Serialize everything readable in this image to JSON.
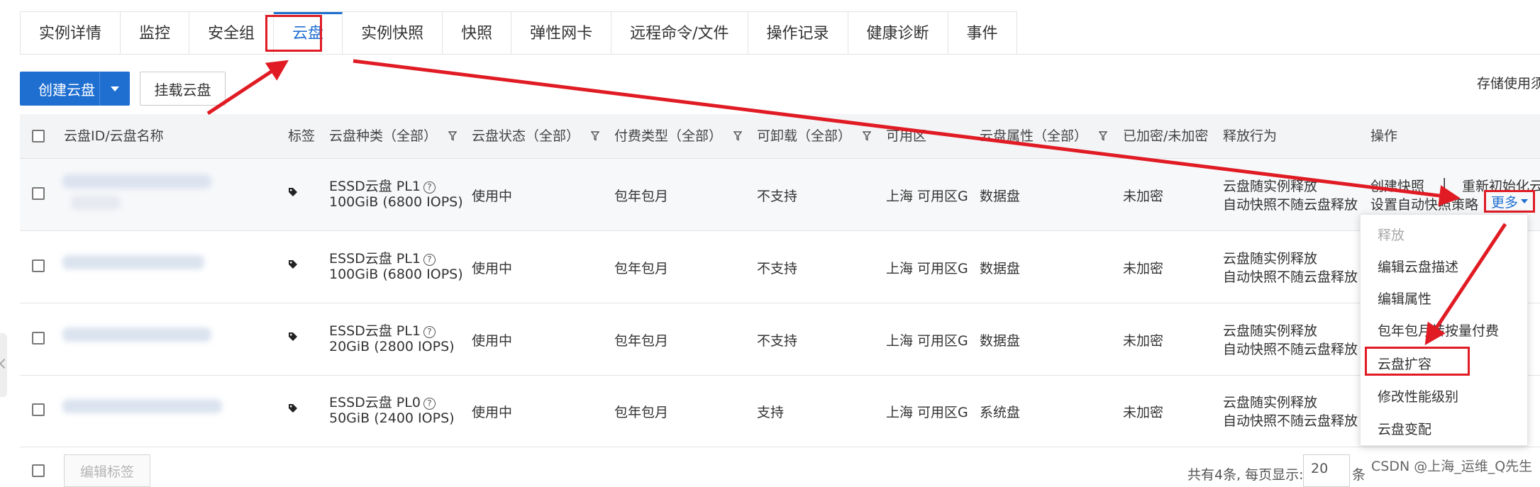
{
  "tabs": [
    "实例详情",
    "监控",
    "安全组",
    "云盘",
    "实例快照",
    "快照",
    "弹性网卡",
    "远程命令/文件",
    "操作记录",
    "健康诊断",
    "事件"
  ],
  "toolbar": {
    "create_label": "创建云盘",
    "mount_label": "挂载云盘",
    "storage_hint": "存储使用须"
  },
  "table": {
    "headers": {
      "id_name": "云盘ID/云盘名称",
      "tag": "标签",
      "type": "云盘种类（全部）",
      "status": "云盘状态（全部）",
      "billing": "付费类型（全部）",
      "detachable": "可卸载（全部）",
      "zone": "可用区",
      "attr": "云盘属性（全部）",
      "encrypt": "已加密/未加密",
      "release": "释放行为",
      "ops": "操作"
    },
    "rows": [
      {
        "type_name": "ESSD云盘  PL1",
        "type_spec": "100GiB (6800 IOPS)",
        "status": "使用中",
        "billing": "包年包月",
        "detachable": "不支持",
        "zone": "上海 可用区G",
        "attr": "数据盘",
        "encrypt": "未加密",
        "release1": "云盘随实例释放",
        "release2": "自动快照不随云盘释放"
      },
      {
        "type_name": "ESSD云盘  PL1",
        "type_spec": "100GiB (6800 IOPS)",
        "status": "使用中",
        "billing": "包年包月",
        "detachable": "不支持",
        "zone": "上海 可用区G",
        "attr": "数据盘",
        "encrypt": "未加密",
        "release1": "云盘随实例释放",
        "release2": "自动快照不随云盘释放"
      },
      {
        "type_name": "ESSD云盘  PL1",
        "type_spec": "20GiB (2800 IOPS)",
        "status": "使用中",
        "billing": "包年包月",
        "detachable": "不支持",
        "zone": "上海 可用区G",
        "attr": "数据盘",
        "encrypt": "未加密",
        "release1": "云盘随实例释放",
        "release2": "自动快照不随云盘释放"
      },
      {
        "type_name": "ESSD云盘  PL0",
        "type_spec": "50GiB (2400 IOPS)",
        "status": "使用中",
        "billing": "包年包月",
        "detachable": "支持",
        "zone": "上海 可用区G",
        "attr": "系统盘",
        "encrypt": "未加密",
        "release1": "云盘随实例释放",
        "release2": "自动快照不随云盘释放"
      }
    ],
    "ops": {
      "create_snapshot": "创建快照",
      "separator": "|",
      "reinit": "重新初始化云盘",
      "auto_snapshot": "设置自动快照策略",
      "more": "更多"
    }
  },
  "dropdown": {
    "items": [
      "释放",
      "编辑云盘描述",
      "编辑属性",
      "包年包月转按量付费",
      "云盘扩容",
      "修改性能级别",
      "云盘变配"
    ]
  },
  "footer": {
    "edit_tag": "编辑标签",
    "total": "共有4条, 每页显示:",
    "page_size": "20",
    "unit": "条"
  },
  "watermark": "CSDN @上海_运维_Q先生",
  "colors": {
    "primary": "#1f6fd1",
    "status_ok": "#1aa53a",
    "annotation": "#e01b24"
  },
  "help_glyph": "?"
}
